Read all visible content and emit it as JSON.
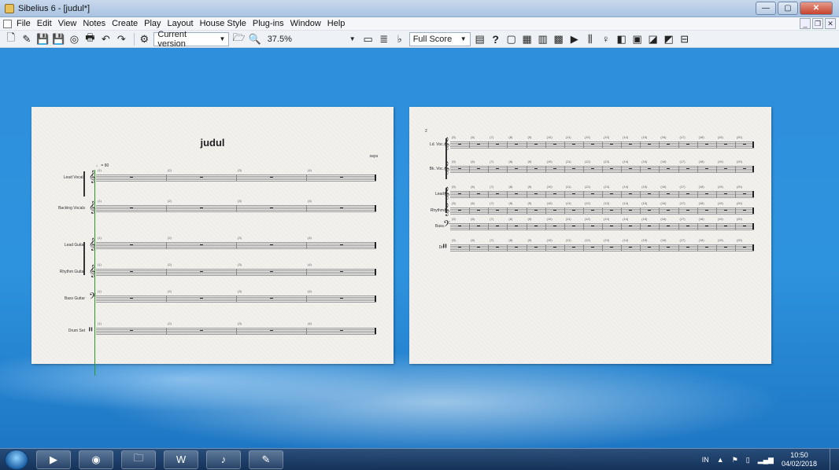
{
  "window": {
    "title": "Sibelius 6 - [judul*]",
    "controls": {
      "minimize": "—",
      "maximize": "▢",
      "close": "✕"
    },
    "mdi": {
      "minimize": "_",
      "restore": "❐",
      "close": "✕"
    }
  },
  "menu": {
    "items": [
      "File",
      "Edit",
      "View",
      "Notes",
      "Create",
      "Play",
      "Layout",
      "House Style",
      "Plug-ins",
      "Window",
      "Help"
    ]
  },
  "toolbar": {
    "version_select": "Current version",
    "zoom_value": "37.5%",
    "view_select": "Full Score",
    "help_label": "?"
  },
  "score": {
    "title": "judul",
    "composer": "saya",
    "tempo": "♩ = 80",
    "page1_instruments": [
      "Lead Vocals",
      "Backing Vocals",
      "Lead Guitar",
      "Rhythm Guitar",
      "Bass Guitar",
      "Drum Set"
    ],
    "page1_measure_numbers": [
      "(1)",
      "(2)",
      "(3)",
      "(4)"
    ],
    "page2_page_number": "2",
    "page2_instruments": [
      "Ld. Voc.",
      "Bk. Voc.",
      "Lead",
      "Rhythm",
      "Bass",
      "Dr."
    ],
    "page2_measure_numbers": [
      "(5)",
      "(6)",
      "(7)",
      "(8)",
      "(9)",
      "(10)",
      "(11)",
      "(12)",
      "(13)",
      "(14)",
      "(15)",
      "(16)",
      "(17)",
      "(18)",
      "(19)",
      "(20)"
    ]
  },
  "taskbar": {
    "apps": [
      "media-player-icon",
      "firefox-icon",
      "explorer-icon",
      "word-icon",
      "sibelius-icon",
      "paint-icon"
    ],
    "language": "IN",
    "time": "10:50",
    "date": "04/02/2018"
  },
  "colors": {
    "accent": "#2e93dc",
    "page": "#f3f1ee",
    "cursor": "#2b9a2b"
  }
}
